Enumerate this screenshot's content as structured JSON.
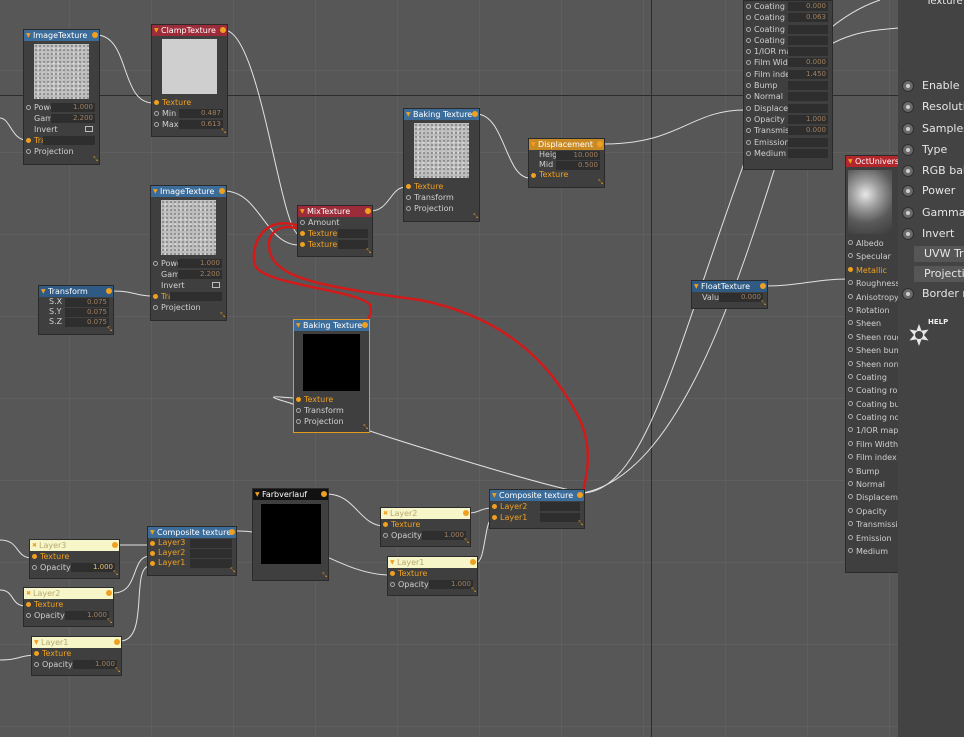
{
  "colors": {
    "wire": "#e2e2e2",
    "annotation": "#d21a1a",
    "accent": "#f0a020"
  },
  "nodes": {
    "image_texture_1": {
      "title": "ImageTexture",
      "rows": [
        {
          "label": "Power",
          "value": "1.000"
        },
        {
          "label": "Gamma",
          "value": "2.200"
        },
        {
          "label": "Invert"
        },
        {
          "label": "Transform"
        },
        {
          "label": "Projection"
        }
      ]
    },
    "clamp_texture": {
      "title": "ClampTexture",
      "rows": [
        {
          "label": "Texture"
        },
        {
          "label": "Min",
          "value": "0.487"
        },
        {
          "label": "Max",
          "value": "0.613"
        }
      ]
    },
    "image_texture_2": {
      "title": "ImageTexture",
      "rows": [
        {
          "label": "Power",
          "value": "1.000"
        },
        {
          "label": "Gamma",
          "value": "2.200"
        },
        {
          "label": "Invert"
        },
        {
          "label": "Transform"
        },
        {
          "label": "Projection"
        }
      ]
    },
    "transform": {
      "title": "Transform",
      "rows": [
        {
          "label": "S.X",
          "value": "0.075"
        },
        {
          "label": "S.Y",
          "value": "0.075"
        },
        {
          "label": "S.Z",
          "value": "0.075"
        }
      ]
    },
    "mix_texture": {
      "title": "MixTexture",
      "rows": [
        {
          "label": "Amount"
        },
        {
          "label": "Texture1"
        },
        {
          "label": "Texture2"
        }
      ]
    },
    "baking_texture_1": {
      "title": "Baking Texture",
      "rows": [
        {
          "label": "Texture"
        },
        {
          "label": "Transform"
        },
        {
          "label": "Projection"
        }
      ]
    },
    "displacement": {
      "title": "Displacement",
      "rows": [
        {
          "label": "Height",
          "value": "10.000"
        },
        {
          "label": "Mid level",
          "value": "0.500"
        },
        {
          "label": "Texture"
        }
      ]
    },
    "baking_texture_2": {
      "title": "Baking Texture",
      "rows": [
        {
          "label": "Texture"
        },
        {
          "label": "Transform"
        },
        {
          "label": "Projection"
        }
      ]
    },
    "float_texture": {
      "title": "FloatTexture",
      "rows": [
        {
          "label": "Value",
          "value": "0.000"
        }
      ]
    },
    "farbverlauf": {
      "title": "Farbverlauf"
    },
    "composite_left": {
      "title": "Composite texture",
      "rows": [
        {
          "label": "Layer3"
        },
        {
          "label": "Layer2"
        },
        {
          "label": "Layer1"
        }
      ]
    },
    "layer3_left": {
      "title": "Layer3",
      "rows": [
        {
          "label": "Texture"
        },
        {
          "label": "Opacity",
          "value": "1.000"
        }
      ]
    },
    "layer2_left": {
      "title": "Layer2",
      "rows": [
        {
          "label": "Texture"
        },
        {
          "label": "Opacity",
          "value": "1.000"
        }
      ]
    },
    "layer1_left": {
      "title": "Layer1",
      "rows": [
        {
          "label": "Texture"
        },
        {
          "label": "Opacity",
          "value": "1.000"
        }
      ]
    },
    "layer2_mid": {
      "title": "Layer2",
      "rows": [
        {
          "label": "Texture"
        },
        {
          "label": "Opacity",
          "value": "1.000"
        }
      ]
    },
    "layer1_mid": {
      "title": "Layer1",
      "rows": [
        {
          "label": "Texture"
        },
        {
          "label": "Opacity",
          "value": "1.000"
        }
      ]
    },
    "composite_right": {
      "title": "Composite texture",
      "rows": [
        {
          "label": "Layer2"
        },
        {
          "label": "Layer1"
        }
      ]
    },
    "material_top": {
      "rows": [
        {
          "label": "Coating",
          "value": "0.000"
        },
        {
          "label": "Coating rou...",
          "value": "0.063"
        },
        {
          "label": "Coating bump"
        },
        {
          "label": "Coating normal"
        },
        {
          "label": "1/IOR map"
        },
        {
          "label": "Film Width",
          "value": "0.000"
        },
        {
          "label": "Film index",
          "value": "1.450"
        },
        {
          "label": "Bump"
        },
        {
          "label": "Normal"
        },
        {
          "label": "Displacement"
        },
        {
          "label": "Opacity",
          "value": "1.000"
        },
        {
          "label": "Transmission",
          "value": "0.000"
        },
        {
          "label": "Emission"
        },
        {
          "label": "Medium"
        }
      ]
    },
    "octane_universal": {
      "title": "OctUniversal",
      "rows": [
        {
          "label": "Albedo"
        },
        {
          "label": "Specular"
        },
        {
          "label": "Metallic"
        },
        {
          "label": "Roughness"
        },
        {
          "label": "Anisotropy"
        },
        {
          "label": "Rotation"
        },
        {
          "label": "Sheen"
        },
        {
          "label": "Sheen roug"
        },
        {
          "label": "Sheen bum"
        },
        {
          "label": "Sheen norm"
        },
        {
          "label": "Coating"
        },
        {
          "label": "Coating rou"
        },
        {
          "label": "Coating bu"
        },
        {
          "label": "Coating no"
        },
        {
          "label": "1/IOR map"
        },
        {
          "label": "Film Width"
        },
        {
          "label": "Film index"
        },
        {
          "label": "Bump"
        },
        {
          "label": "Normal"
        },
        {
          "label": "Displaceme"
        },
        {
          "label": "Opacity"
        },
        {
          "label": "Transmission"
        },
        {
          "label": "Emission"
        },
        {
          "label": "Medium"
        }
      ]
    }
  },
  "panel": {
    "top_label": "Texture",
    "options": [
      {
        "label": "Enable b"
      },
      {
        "label": "Resoluti"
      },
      {
        "label": "Samples"
      },
      {
        "label": "Type"
      },
      {
        "label": "RGB bak"
      },
      {
        "label": "Power"
      },
      {
        "label": "Gamma"
      },
      {
        "label": "Invert"
      }
    ],
    "buttons": [
      {
        "label": "UVW Tra"
      },
      {
        "label": "Projectio"
      }
    ],
    "border_option": "Border m",
    "help": "HELP"
  }
}
